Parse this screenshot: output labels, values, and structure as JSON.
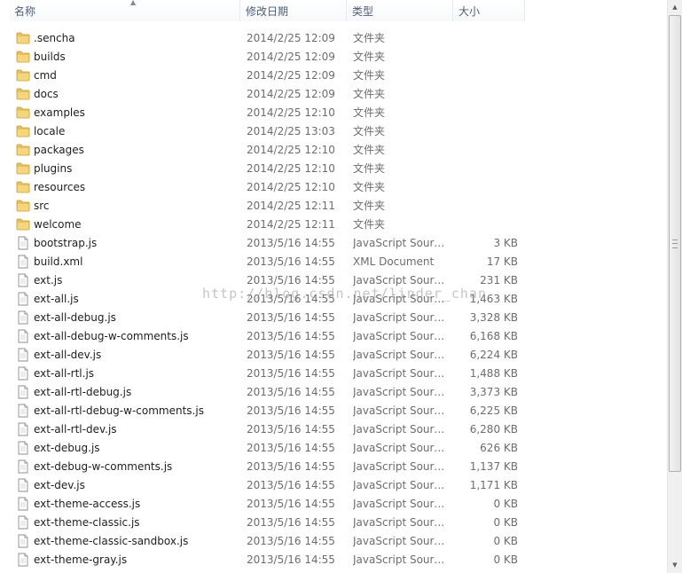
{
  "columns": {
    "name": "名称",
    "date": "修改日期",
    "type": "类型",
    "size": "大小"
  },
  "sort_indicator": "▲",
  "watermark": "http://blog.csdn.net/linder_chan",
  "scrollbar": {
    "up": "▲",
    "down": "▼"
  },
  "files": [
    {
      "name": ".sencha",
      "date": "2014/2/25 12:09",
      "type": "文件夹",
      "size": "",
      "icon": "folder-icon"
    },
    {
      "name": "builds",
      "date": "2014/2/25 12:09",
      "type": "文件夹",
      "size": "",
      "icon": "folder-icon"
    },
    {
      "name": "cmd",
      "date": "2014/2/25 12:09",
      "type": "文件夹",
      "size": "",
      "icon": "folder-icon"
    },
    {
      "name": "docs",
      "date": "2014/2/25 12:09",
      "type": "文件夹",
      "size": "",
      "icon": "folder-icon"
    },
    {
      "name": "examples",
      "date": "2014/2/25 12:10",
      "type": "文件夹",
      "size": "",
      "icon": "folder-icon"
    },
    {
      "name": "locale",
      "date": "2014/2/25 13:03",
      "type": "文件夹",
      "size": "",
      "icon": "folder-icon"
    },
    {
      "name": "packages",
      "date": "2014/2/25 12:10",
      "type": "文件夹",
      "size": "",
      "icon": "folder-icon"
    },
    {
      "name": "plugins",
      "date": "2014/2/25 12:10",
      "type": "文件夹",
      "size": "",
      "icon": "folder-icon"
    },
    {
      "name": "resources",
      "date": "2014/2/25 12:10",
      "type": "文件夹",
      "size": "",
      "icon": "folder-icon"
    },
    {
      "name": "src",
      "date": "2014/2/25 12:11",
      "type": "文件夹",
      "size": "",
      "icon": "folder-icon"
    },
    {
      "name": "welcome",
      "date": "2014/2/25 12:11",
      "type": "文件夹",
      "size": "",
      "icon": "folder-icon"
    },
    {
      "name": "bootstrap.js",
      "date": "2013/5/16 14:55",
      "type": "JavaScript Sourc...",
      "size": "3 KB",
      "icon": "file-icon"
    },
    {
      "name": "build.xml",
      "date": "2013/5/16 14:55",
      "type": "XML Document",
      "size": "17 KB",
      "icon": "file-icon"
    },
    {
      "name": "ext.js",
      "date": "2013/5/16 14:55",
      "type": "JavaScript Sourc...",
      "size": "231 KB",
      "icon": "file-icon"
    },
    {
      "name": "ext-all.js",
      "date": "2013/5/16 14:55",
      "type": "JavaScript Sourc...",
      "size": "1,463 KB",
      "icon": "file-icon"
    },
    {
      "name": "ext-all-debug.js",
      "date": "2013/5/16 14:55",
      "type": "JavaScript Sourc...",
      "size": "3,328 KB",
      "icon": "file-icon"
    },
    {
      "name": "ext-all-debug-w-comments.js",
      "date": "2013/5/16 14:55",
      "type": "JavaScript Sourc...",
      "size": "6,168 KB",
      "icon": "file-icon"
    },
    {
      "name": "ext-all-dev.js",
      "date": "2013/5/16 14:55",
      "type": "JavaScript Sourc...",
      "size": "6,224 KB",
      "icon": "file-icon"
    },
    {
      "name": "ext-all-rtl.js",
      "date": "2013/5/16 14:55",
      "type": "JavaScript Sourc...",
      "size": "1,488 KB",
      "icon": "file-icon"
    },
    {
      "name": "ext-all-rtl-debug.js",
      "date": "2013/5/16 14:55",
      "type": "JavaScript Sourc...",
      "size": "3,373 KB",
      "icon": "file-icon"
    },
    {
      "name": "ext-all-rtl-debug-w-comments.js",
      "date": "2013/5/16 14:55",
      "type": "JavaScript Sourc...",
      "size": "6,225 KB",
      "icon": "file-icon"
    },
    {
      "name": "ext-all-rtl-dev.js",
      "date": "2013/5/16 14:55",
      "type": "JavaScript Sourc...",
      "size": "6,280 KB",
      "icon": "file-icon"
    },
    {
      "name": "ext-debug.js",
      "date": "2013/5/16 14:55",
      "type": "JavaScript Sourc...",
      "size": "626 KB",
      "icon": "file-icon"
    },
    {
      "name": "ext-debug-w-comments.js",
      "date": "2013/5/16 14:55",
      "type": "JavaScript Sourc...",
      "size": "1,137 KB",
      "icon": "file-icon"
    },
    {
      "name": "ext-dev.js",
      "date": "2013/5/16 14:55",
      "type": "JavaScript Sourc...",
      "size": "1,171 KB",
      "icon": "file-icon"
    },
    {
      "name": "ext-theme-access.js",
      "date": "2013/5/16 14:55",
      "type": "JavaScript Sourc...",
      "size": "0 KB",
      "icon": "file-icon"
    },
    {
      "name": "ext-theme-classic.js",
      "date": "2013/5/16 14:55",
      "type": "JavaScript Sourc...",
      "size": "0 KB",
      "icon": "file-icon"
    },
    {
      "name": "ext-theme-classic-sandbox.js",
      "date": "2013/5/16 14:55",
      "type": "JavaScript Sourc...",
      "size": "0 KB",
      "icon": "file-icon"
    },
    {
      "name": "ext-theme-gray.js",
      "date": "2013/5/16 14:55",
      "type": "JavaScript Sourc...",
      "size": "0 KB",
      "icon": "file-icon"
    }
  ],
  "colors": {
    "header_text": "#4c607a",
    "detail_text": "#6d6d6d",
    "folder": "#e8c25a"
  }
}
